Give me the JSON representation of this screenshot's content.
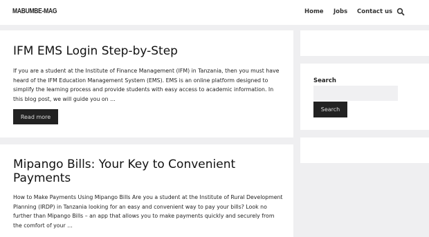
{
  "header": {
    "logo_text": "MABUMBE-MAG",
    "nav": {
      "home": "Home",
      "jobs": "Jobs",
      "contact": "Contact us"
    },
    "search_icon": "search-icon"
  },
  "posts": [
    {
      "title": "IFM EMS Login Step-by-Step",
      "excerpt": "If you are a student at the Institute of Finance Management (IFM) in Tanzania, then you must have heard of the IFM Education Management System (EMS). EMS is an online platform designed to simplify the learning process and provide students with easy access to academic information. In this blog post, we will guide you on …",
      "read_more": "Read more"
    },
    {
      "title": "Mipango Bills: Your Key to Convenient Payments",
      "excerpt": "How to Make Payments Using Mipango Bills Are you a student at the Institute of Rural Development Planning (IRDP) in Tanzania looking for an easy and convenient way to pay your bills? Look no further than Mipango Bills – an app that allows you to make payments quickly and securely from the comfort of your …"
    }
  ],
  "sidebar": {
    "search_label": "Search",
    "search_placeholder": "",
    "search_button": "Search"
  },
  "colors": {
    "background": "#efeff1",
    "panel": "#ffffff",
    "button": "#222222"
  }
}
